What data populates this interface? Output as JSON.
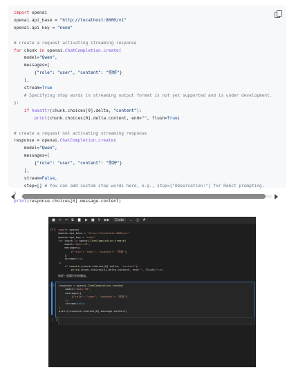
{
  "code_block": {
    "copy_button": "copy-icon",
    "lines": [
      "import openai",
      "openai.api_base = \"http://localhost:8000/v1\"",
      "openai.api_key = \"none\"",
      "",
      "# create a request activating streaming response",
      "for chunk in openai.ChatCompletion.create(",
      "    model=\"Qwen\",",
      "    messages=[",
      "        {\"role\": \"user\", \"content\": \"你好\"}",
      "    ],",
      "    stream=True",
      "    # Specifying stop words in streaming output format is not yet supported and is under development.",
      "):",
      "    if hasattr(chunk.choices[0].delta, \"content\"):",
      "        print(chunk.choices[0].delta.content, end=\"\", flush=True)",
      "",
      "# create a request not activating streaming response",
      "response = openai.ChatCompletion.create(",
      "    model=\"Qwen\",",
      "    messages=[",
      "        {\"role\": \"user\", \"content\": \"你好\"}",
      "    ],",
      "    stream=False,",
      "    stop=[] # You can add custom stop words here, e.g., stop=[\"Observation:\"] for ReAct prompting.",
      ")",
      "print(response.choices[0].message.content)"
    ]
  },
  "scrollbar": {
    "position": 0.0
  },
  "notebook": {
    "toolbar": [
      "■",
      "+",
      "✂",
      "⧉",
      "📋",
      "▶",
      "■",
      "↻",
      "▶▶",
      "Code",
      "⌄",
      "⓵",
      "#"
    ],
    "toolbar_mode": "Code",
    "cell1_prompt": "[5]:",
    "cell1_lines": [
      "import openai",
      "openai.api_base = \"http://localhost:8000/v1\"",
      "openai.api_key = \"none\"",
      "for chunk in openai.ChatCompletion.create(",
      "    model=\"Qwen-7B\",",
      "    messages=[",
      "        {\"role\": \"user\", \"content\": \"你好\"}",
      "    ],",
      "    stream=True",
      "):",
      "    if hasattr(chunk.choices[0].delta, \"content\"):",
      "        print(chunk.choices[0].delta.content, end=\"\", flush=True)"
    ],
    "cell1_output": "你好！很高兴为你服务。",
    "cell2_prompt": "[ ]:",
    "cell2_lines": [
      "response = openai.ChatCompletion.create(",
      "    model=\"Qwen-7B\",",
      "    messages=[",
      "        {\"role\": \"user\", \"content\": \"你好\"}",
      "    ],",
      "    stream=False",
      ")",
      "print(response.choices[0].message.content)"
    ],
    "cell3_prompt": "[ ]:"
  }
}
